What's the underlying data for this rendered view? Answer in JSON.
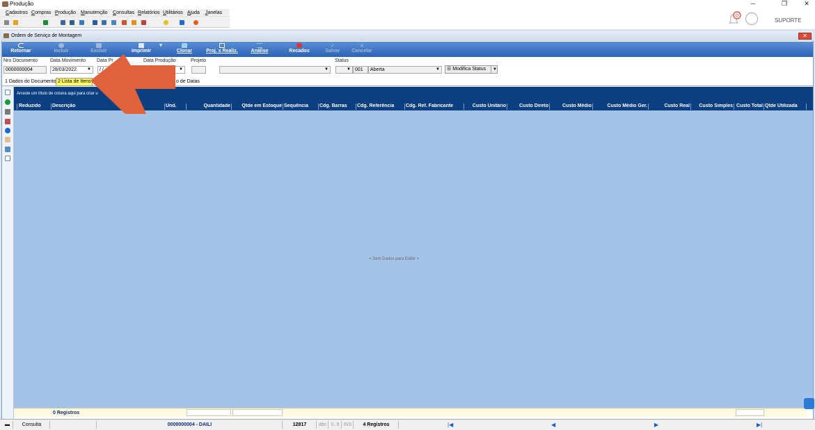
{
  "window": {
    "title": "Produção"
  },
  "menu": [
    "Cadastros",
    "Compras",
    "Produção",
    "Manutenção",
    "Consultas",
    "Relatórios",
    "Utilitários",
    "Ajuda",
    "Janelas"
  ],
  "notifications": {
    "count": "0"
  },
  "user": {
    "name": "SUPORTE"
  },
  "child_window": {
    "title": "Ordem de Serviço de Montagem"
  },
  "ribbon": {
    "buttons": [
      {
        "label": "Retornar",
        "icon": "return-icon",
        "enabled": true
      },
      {
        "label": "Incluir",
        "icon": "add-icon",
        "enabled": false
      },
      {
        "label": "Excluir",
        "icon": "trash-icon",
        "enabled": false
      },
      {
        "label": "Imprimir",
        "icon": "printer-icon",
        "enabled": true
      },
      {
        "label": "Clonar",
        "icon": "clone-icon",
        "enabled": true
      },
      {
        "label": "Proj. x Realiz.",
        "icon": "compare-icon",
        "enabled": true
      },
      {
        "label": "Análise",
        "icon": "list-icon",
        "enabled": true
      },
      {
        "label": "Recados",
        "icon": "record-icon",
        "enabled": true
      },
      {
        "label": "Salvar",
        "icon": "check-icon",
        "enabled": false
      },
      {
        "label": "Cancelar",
        "icon": "x-icon",
        "enabled": false
      }
    ]
  },
  "form": {
    "nro_documento": {
      "label": "Nro Documento",
      "value": "0000000004"
    },
    "data_movimento": {
      "label": "Data Movimento",
      "value": "28/03/2022"
    },
    "data_previsao": {
      "label": "Data Pr",
      "value": "/ /"
    },
    "data_producao": {
      "label": "Data Produção",
      "value": "/ /"
    },
    "projeto": {
      "label": "Projeto",
      "value": ""
    },
    "status": {
      "label": "Status",
      "code": "001",
      "value": "Aberta"
    },
    "modifica_status": "Modifica Status"
  },
  "tabs": [
    {
      "label": "1 Dados do Documento",
      "active": false
    },
    {
      "label": "2 Lista de Itens",
      "active": true
    },
    {
      "label": "o de Datas",
      "active": false
    }
  ],
  "grid": {
    "group_hint": "Arraste um título de coluna aqui para criar u",
    "columns": [
      "Reduzido",
      "Descrição",
      "Und.",
      "Quantidade",
      "Qtde em Estoque",
      "Sequência",
      "Cdg. Barras",
      "Cdg. Referência",
      "Cdg. Ref. Fabricante",
      "Custo Unitário",
      "Custo Direto",
      "Custo Médio",
      "Custo Médio Ger.",
      "Custo Real",
      "Custo Simples",
      "Custo Total",
      "Qtde Utilizada"
    ],
    "empty_text": "< Sem Dados para Exibir >",
    "footer_count": "0 Registros"
  },
  "statusbar": {
    "mode": "Consulta",
    "document": "0000000004 - DAILI",
    "code": "12817",
    "abc": "abc",
    "digits": "0..9",
    "ins": "INS",
    "records": "4 Registros"
  },
  "colors": {
    "accent": "#0a3f82",
    "grid_bg": "#a5c3e8",
    "arrow": "#e0623a",
    "active_tab": "#ffff66"
  }
}
